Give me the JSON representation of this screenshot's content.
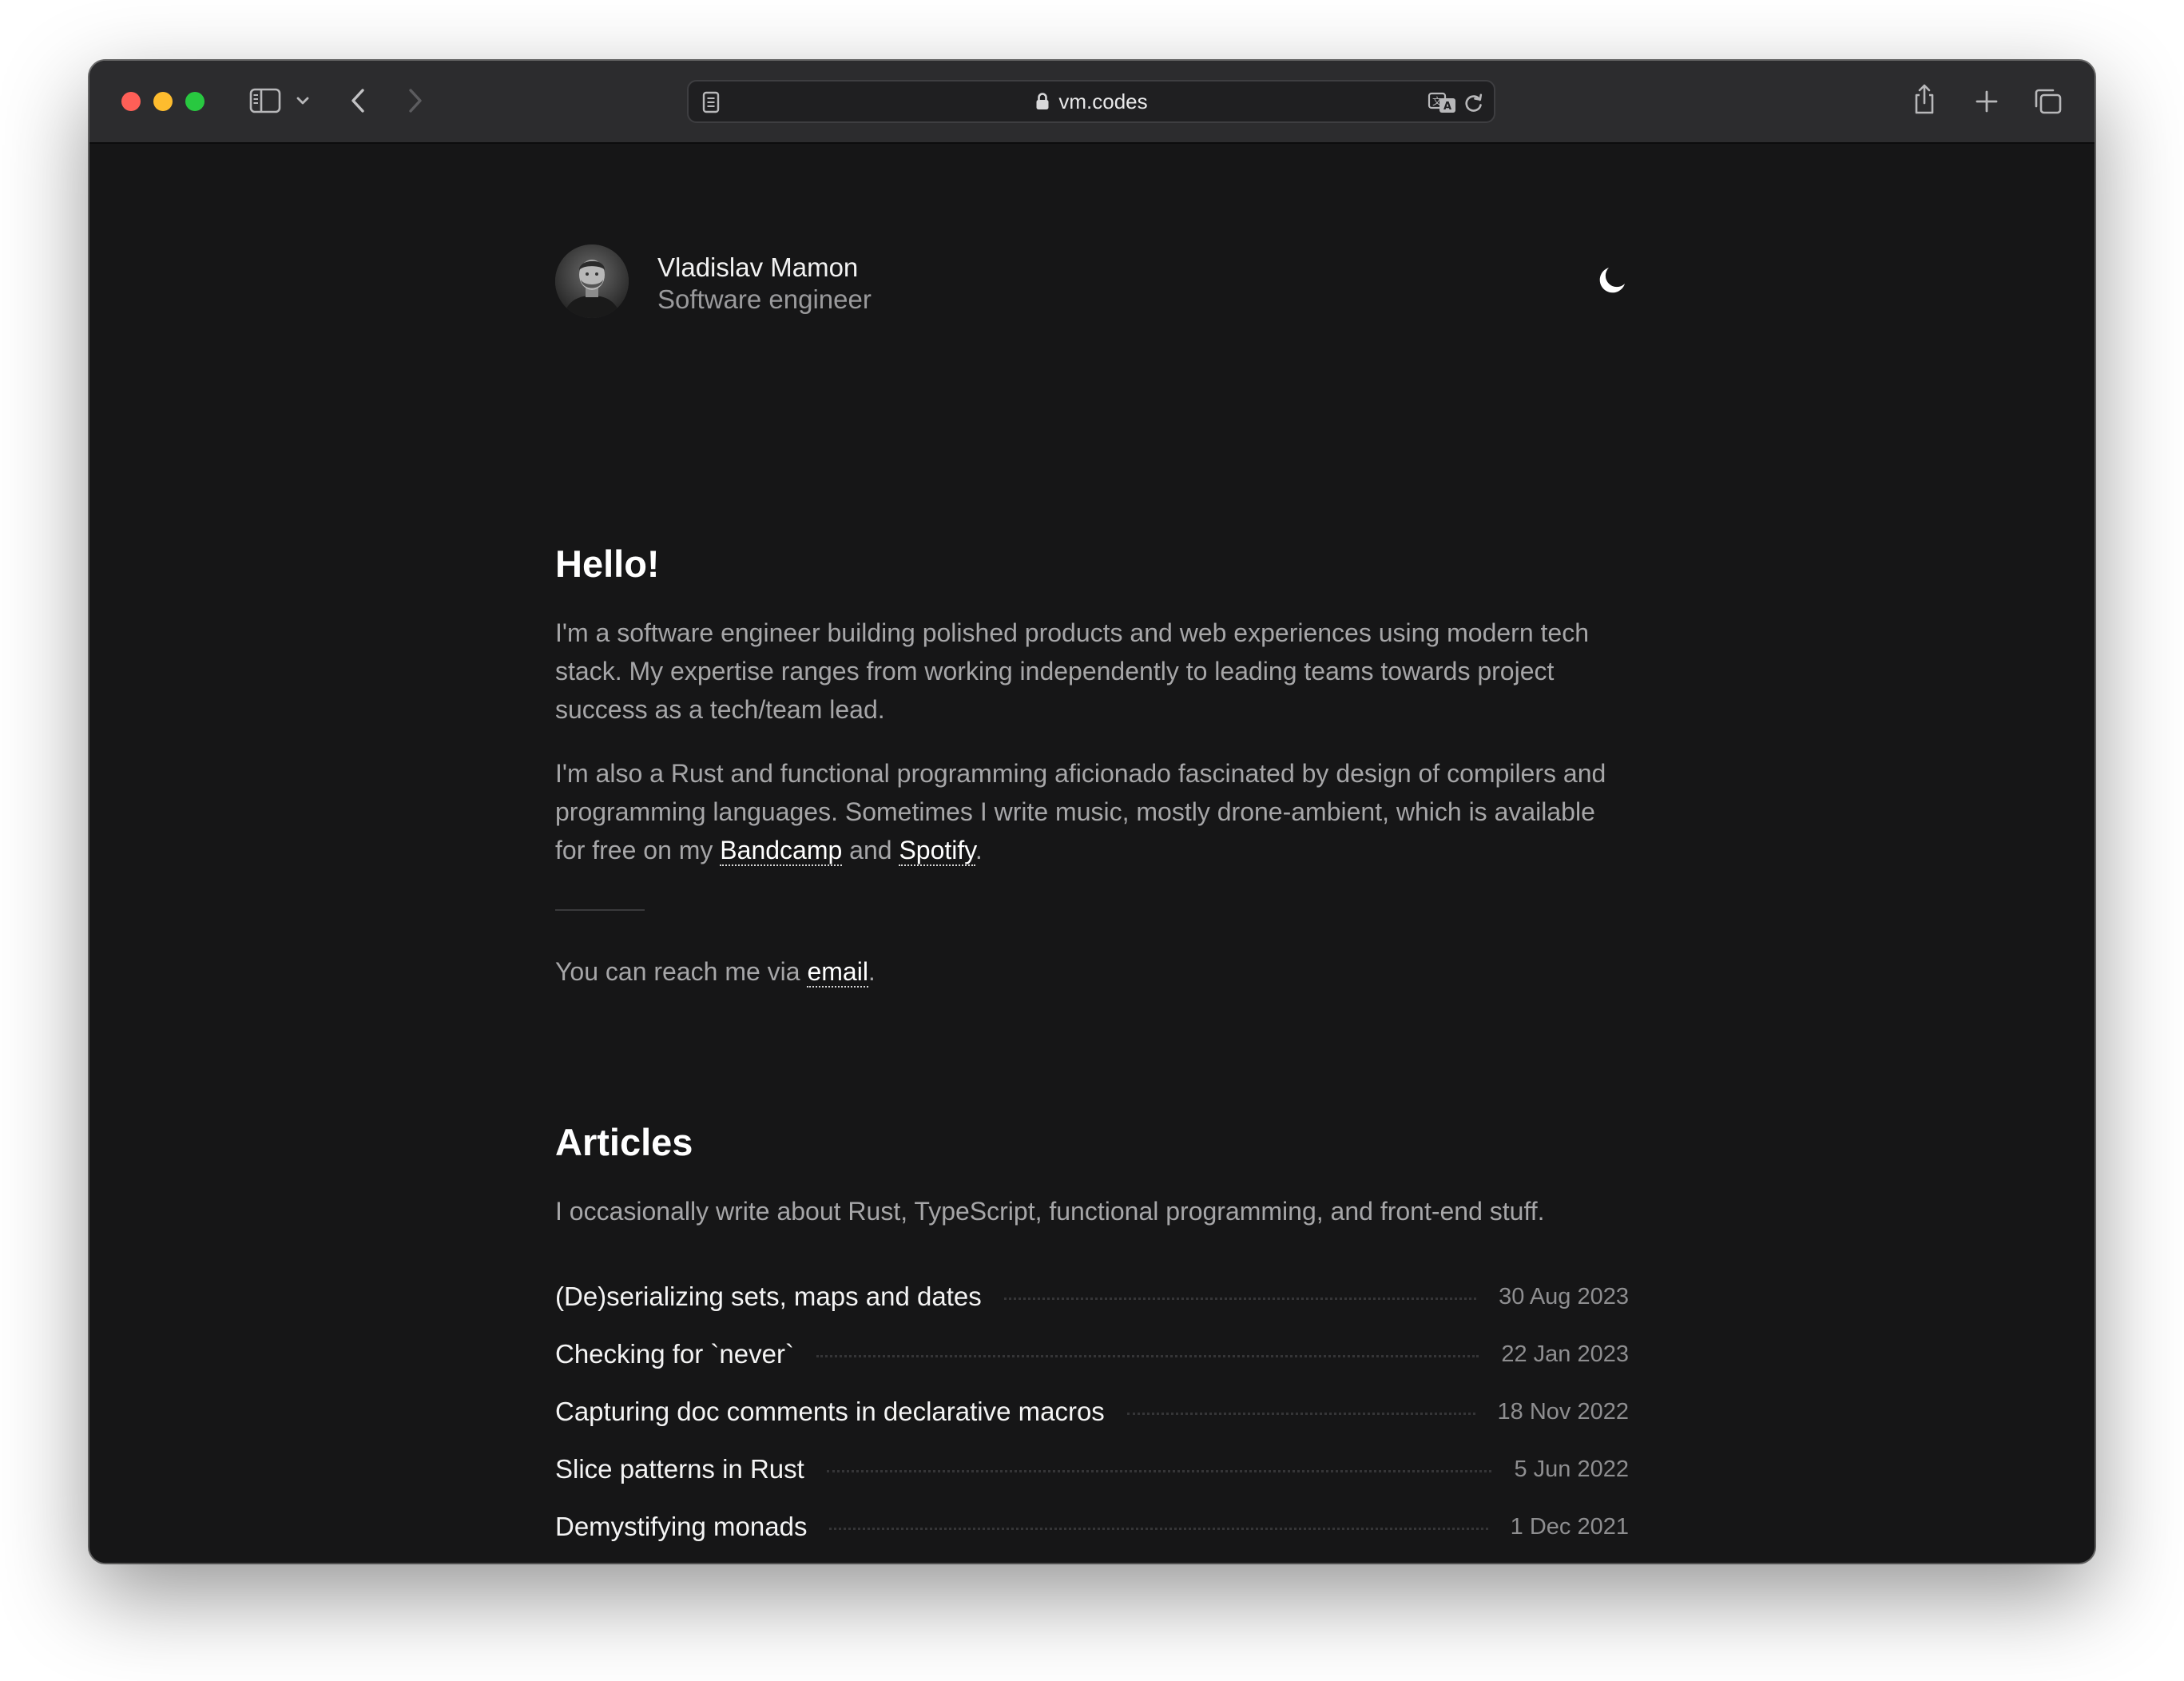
{
  "browser": {
    "url": "vm.codes",
    "icons": {
      "sidebar": "sidebar-icon",
      "chevron": "chevron-down-icon",
      "back": "back-arrow-icon",
      "forward": "forward-arrow-icon",
      "reader": "reader-icon",
      "lock": "lock-icon",
      "translate": "translate-icon",
      "reload": "reload-icon",
      "share": "share-icon",
      "new_tab": "plus-icon",
      "tabs": "tabs-overview-icon"
    },
    "traffic_lights": [
      "#fe5f57",
      "#febc2e",
      "#28c840"
    ]
  },
  "profile": {
    "name": "Vladislav Mamon",
    "role": "Software engineer",
    "theme_icon": "moon-icon"
  },
  "hello": {
    "heading": "Hello!",
    "p1": "I'm a software engineer building polished products and web experiences using modern tech stack. My expertise ranges from working independently to leading teams towards project success as a tech/team lead.",
    "p2_a": "I'm also a Rust and functional programming aficionado fascinated by design of compilers and programming languages. Sometimes I write music, mostly drone-ambient, which is available for free on my ",
    "bandcamp": "Bandcamp",
    "p2_and": " and ",
    "spotify": "Spotify",
    "p2_end": ".",
    "reach_pre": "You can reach me via ",
    "email": "email",
    "reach_end": "."
  },
  "articles": {
    "heading": "Articles",
    "intro": "I occasionally write about Rust, TypeScript, functional programming, and front-end stuff.",
    "items": [
      {
        "title": "(De)serializing sets, maps and dates",
        "date": "30 Aug 2023"
      },
      {
        "title": "Checking for `never`",
        "date": "22 Jan 2023"
      },
      {
        "title": "Capturing doc comments in declarative macros",
        "date": "18 Nov 2022"
      },
      {
        "title": "Slice patterns in Rust",
        "date": "5 Jun 2022"
      },
      {
        "title": "Demystifying monads",
        "date": "1 Dec 2021"
      }
    ]
  },
  "colors": {
    "page_bg": "#161617",
    "toolbar_bg": "#2c2c2e",
    "text": "#ffffff",
    "muted": "#a6a6a8",
    "date": "#8e8e90"
  }
}
